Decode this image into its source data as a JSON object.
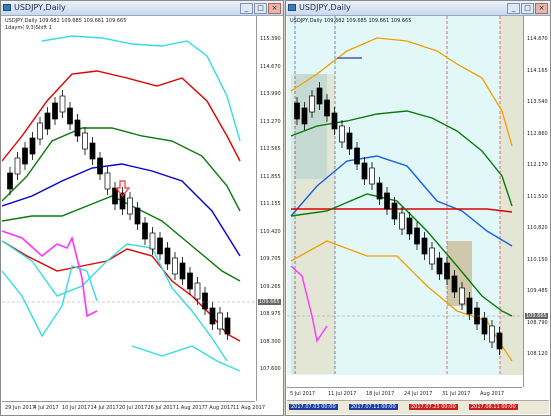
{
  "left_window": {
    "title": "USDJPY,Daily",
    "chart_title": "USDJPY,Daily 109.682 109.685 109.661 109.665",
    "indicator_label": "1daym( 9,3)Shift 1",
    "y_labels": [
      "115.390",
      "114.670",
      "113.990",
      "113.270",
      "112.565",
      "111.855",
      "111.155",
      "110.420",
      "109.705",
      "109.265",
      "108.975",
      "108.300",
      "107.600"
    ],
    "x_labels": [
      "29 Jun 2017",
      "4 Jul 2017",
      "10 Jul 2017",
      "14 Jul 2017",
      "20 Jul 2017",
      "26 Jul 2017",
      "1 Aug 2017",
      "7 Aug 2017",
      "11 Aug 2017"
    ],
    "price_tag": "109.665",
    "buttons": {
      "minimize": "_",
      "maximize": "□",
      "close": "×"
    },
    "colors": {
      "outer_band": "#33dde0",
      "sigma2": "#e00000",
      "sigma1": "#0a7a0a",
      "center": "#0000d8",
      "oscillator": "#ff33ff",
      "arrow": "#ff3030"
    }
  },
  "right_window": {
    "title": "USDJPY,Daily",
    "chart_title": "USDJPY,Daily 109.682 109.685 109.661 109.665",
    "y_labels": [
      "114.870",
      "114.165",
      "113.540",
      "112.860",
      "112.170",
      "111.510",
      "110.820",
      "110.150",
      "109.485",
      "108.790",
      "108.120"
    ],
    "price_tag": "109.665",
    "x_labels": [
      "5 Jul 2017",
      "11 Jul 2017",
      "18 Jul 2017",
      "24 Jul 2017",
      "31 Jul 2017",
      "Aug 2017"
    ],
    "time_tags": [
      {
        "text": "2017.07.03 00:00",
        "color": "#1f3fa0"
      },
      {
        "text": "2017.07.11 00:00",
        "color": "#1f3fa0"
      },
      {
        "text": "2017.07.25 00:00",
        "color": "#cc2020"
      },
      {
        "text": "2017.08.11 00:00",
        "color": "#cc2020"
      }
    ],
    "buttons": {
      "minimize": "_",
      "maximize": "□",
      "close": "×"
    },
    "colors": {
      "background": "#e1f7f8",
      "envelope": "#f0a000",
      "mid": "#0a7a0a",
      "blue_line": "#1a5fe0",
      "red_line": "#e00000",
      "highlight_blue": "#7fd0f0",
      "highlight_tan": "#e8d8b8"
    }
  },
  "chart_data": [
    {
      "type": "candlestick",
      "title": "USDJPY,Daily",
      "ylim": [
        107.6,
        115.39
      ],
      "x": [
        "29 Jun 2017",
        "4 Jul 2017",
        "10 Jul 2017",
        "14 Jul 2017",
        "20 Jul 2017",
        "26 Jul 2017",
        "1 Aug 2017",
        "7 Aug 2017",
        "11 Aug 2017"
      ],
      "series": [
        {
          "name": "Close",
          "values": [
            112.3,
            113.4,
            114.1,
            112.6,
            111.8,
            111.1,
            110.3,
            110.2,
            109.665
          ]
        }
      ]
    },
    {
      "type": "candlestick",
      "title": "USDJPY,Daily",
      "ylim": [
        108.12,
        114.87
      ],
      "x": [
        "5 Jul 2017",
        "11 Jul 2017",
        "18 Jul 2017",
        "24 Jul 2017",
        "31 Jul 2017",
        "Aug 2017"
      ],
      "series": [
        {
          "name": "Close",
          "values": [
            113.2,
            113.9,
            112.2,
            111.2,
            110.4,
            109.665
          ]
        }
      ]
    }
  ]
}
